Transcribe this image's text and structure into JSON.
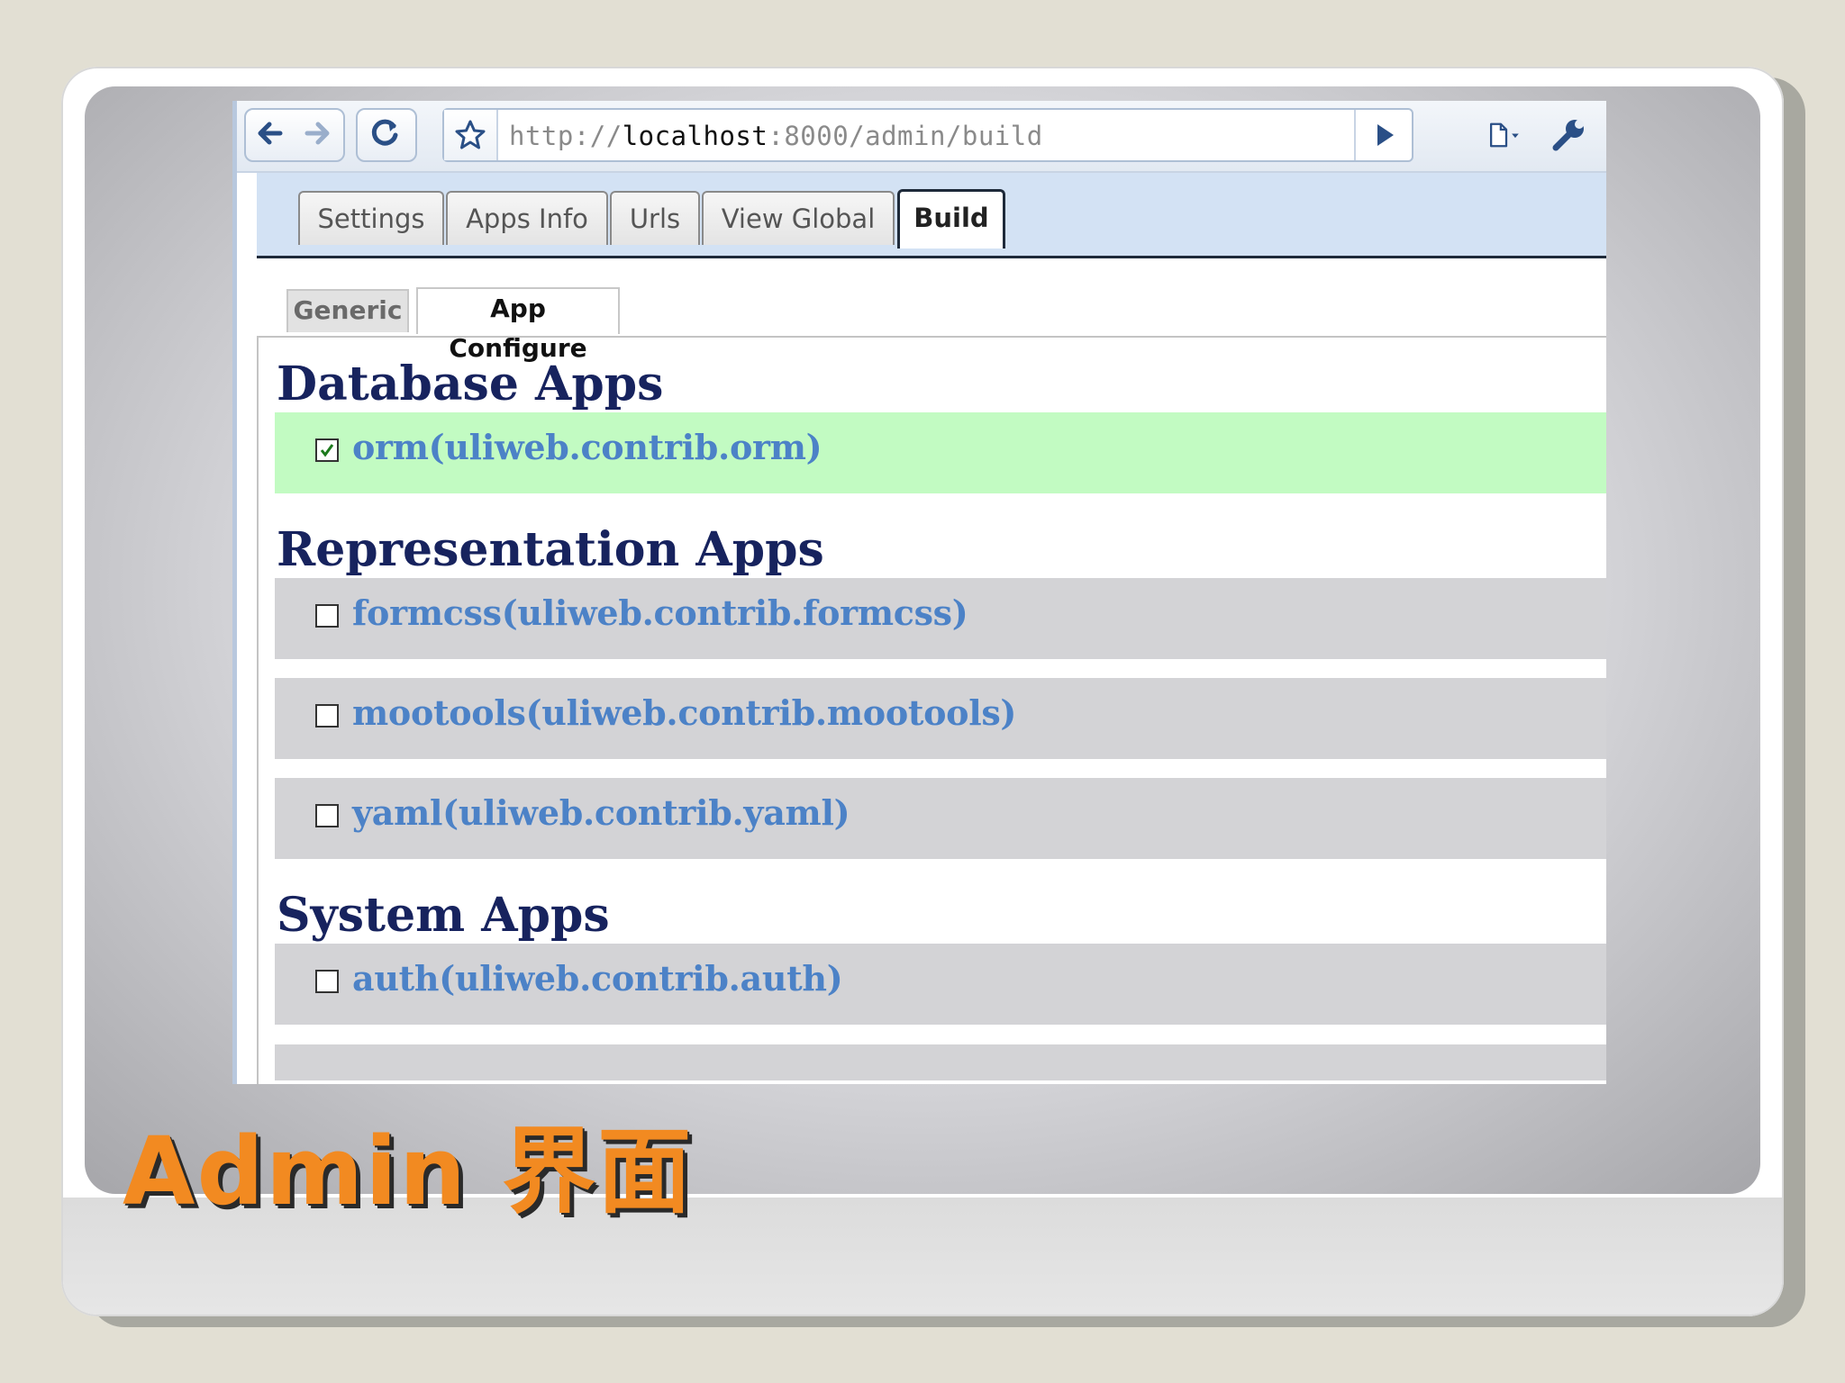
{
  "browser": {
    "url_prefix": "http://",
    "url_host": "localhost",
    "url_rest": ":8000/admin/build"
  },
  "tabs": [
    "Settings",
    "Apps Info",
    "Urls",
    "View Global",
    "Build"
  ],
  "active_tab": "Build",
  "subtabs": [
    "Generic",
    "App Configure"
  ],
  "active_subtab": "App Configure",
  "sections": [
    {
      "title": "Database Apps",
      "apps": [
        {
          "label": "orm(uliweb.contrib.orm)",
          "checked": true
        }
      ]
    },
    {
      "title": "Representation Apps",
      "apps": [
        {
          "label": "formcss(uliweb.contrib.formcss)",
          "checked": false
        },
        {
          "label": "mootools(uliweb.contrib.mootools)",
          "checked": false
        },
        {
          "label": "yaml(uliweb.contrib.yaml)",
          "checked": false
        }
      ]
    },
    {
      "title": "System Apps",
      "apps": [
        {
          "label": "auth(uliweb.contrib.auth)",
          "checked": false
        }
      ]
    }
  ],
  "slide_title": "Admin 界面",
  "colors": {
    "heading": "#17235e",
    "app_link": "#4c82c7",
    "checked_row": "#c2fbc2",
    "row": "#d3d3d6",
    "slide_title": "#f28a21"
  },
  "icons": [
    "back-arrow-icon",
    "forward-arrow-icon",
    "reload-icon",
    "star-icon",
    "go-icon",
    "page-icon",
    "wrench-icon"
  ]
}
